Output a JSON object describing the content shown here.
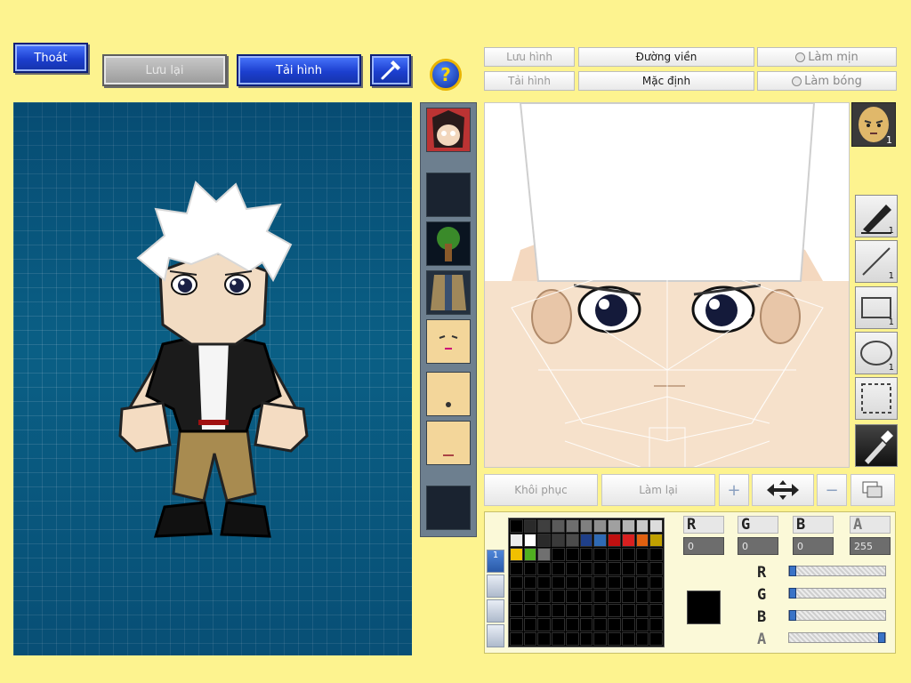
{
  "top_bar": {
    "exit_label": "Thoát",
    "save_label": "Lưu lại",
    "reload_label": "Tải hình"
  },
  "editor_toolbar": {
    "save_image": "Lưu hình",
    "load_image": "Tải hình",
    "outline": "Đường viền",
    "default": "Mặc định",
    "smooth": "Làm mịn",
    "shade": "Làm bóng"
  },
  "bottom_buttons": {
    "restore": "Khôi phục",
    "redo": "Làm lại"
  },
  "tools": {
    "face_layer_num": "1",
    "pen_num": "1",
    "line_num": "1",
    "rect_num": "1",
    "ellipse_num": "1"
  },
  "palette": {
    "layer_tab": "1",
    "row1": [
      "#000000",
      "#2a2a2a",
      "#3f3f3f",
      "#5a5a5a",
      "#6e6e6e",
      "#7f7f7f",
      "#8f8f8f",
      "#a0a0a0",
      "#b4b4b4",
      "#c8c8c8",
      "#dcdcdc"
    ],
    "row2": [
      "#ececec",
      "#ffffff",
      "#2a2a2a",
      "#3a3a3a",
      "#4c4c4c",
      "#1f3f88",
      "#2f6ab4",
      "#c01010",
      "#d82020",
      "#e06010",
      "#c0a000"
    ],
    "row3": [
      "#f0c000",
      "#50b020",
      "#707070"
    ]
  },
  "channels": {
    "r_value": "0",
    "g_value": "0",
    "b_value": "0",
    "a_value": "255",
    "r_level": 0,
    "g_level": 0,
    "b_level": 0,
    "a_level": 1.0
  },
  "current_color": "#000000"
}
